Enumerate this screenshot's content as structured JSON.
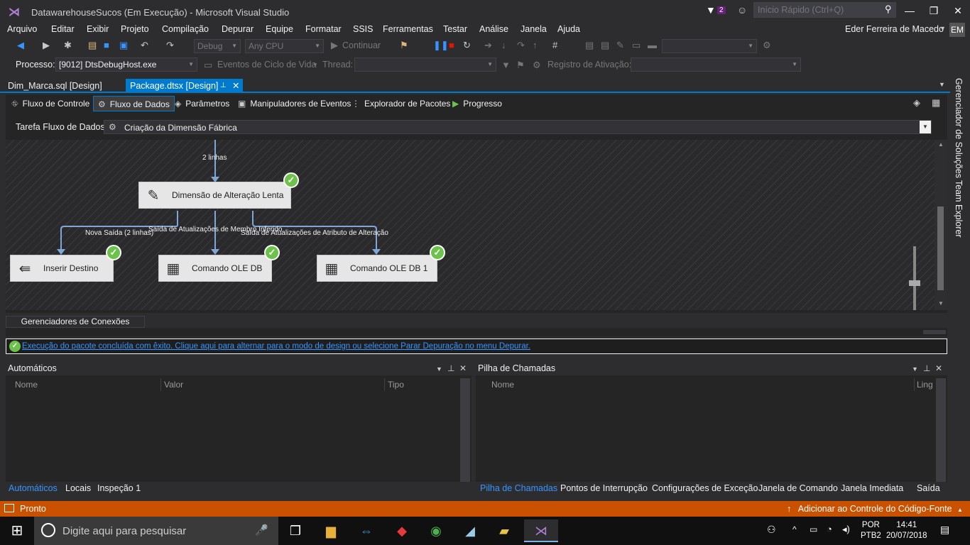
{
  "window": {
    "title": "DatawarehouseSucos (Em Execução) - Microsoft Visual Studio",
    "notification_count": "2",
    "quick_launch_placeholder": "Início Rápido (Ctrl+Q)",
    "user_name": "Eder Ferreira de Macedo",
    "user_initials": "EM"
  },
  "menu": [
    "Arquivo",
    "Editar",
    "Exibir",
    "Projeto",
    "Compilação",
    "Depurar",
    "Equipe",
    "Formatar",
    "SSIS",
    "Ferramentas",
    "Testar",
    "Análise",
    "Janela",
    "Ajuda"
  ],
  "toolbar": {
    "config": "Debug",
    "platform": "Any CPU",
    "continue_label": "Continuar",
    "process_label": "Processo:",
    "process_value": "[9012] DtsDebugHost.exe",
    "lifecycle_label": "Eventos de Ciclo de Vida",
    "thread_label": "Thread:",
    "activation_label": "Registro de Ativação:"
  },
  "doc_tabs": [
    {
      "label": "Dim_Marca.sql [Design]"
    },
    {
      "label": "Package.dtsx [Design]"
    }
  ],
  "ssis_tabs": [
    "Fluxo de Controle",
    "Fluxo de Dados",
    "Parâmetros",
    "Manipuladores de Eventos",
    "Explorador de Pacotes",
    "Progresso"
  ],
  "task": {
    "label": "Tarefa Fluxo de Dados:",
    "value": "Criação da Dimensão Fábrica"
  },
  "canvas": {
    "rows_label": "2 linhas",
    "scd_node": "Dimensão de Alteração Lenta",
    "flow_new": "Nova Saída (2 linhas)",
    "flow_inferred": "Saída de Atualizações de Membro Inferido",
    "flow_attr": "Saída de Atualizações de Atributo de Alteração",
    "dest_node": "Inserir Destino",
    "ole1_node": "Comando OLE DB",
    "ole2_node": "Comando OLE DB 1"
  },
  "connections_tab": "Gerenciadores de Conexões",
  "status_message": "Execução do pacote concluída com êxito. Clique aqui para alternar para o modo de design ou selecione Parar Depuração no menu Depurar.",
  "autos_panel": {
    "title": "Automáticos",
    "columns": [
      "Nome",
      "Valor",
      "Tipo"
    ],
    "tabs": [
      "Automáticos",
      "Locais",
      "Inspeção 1"
    ]
  },
  "callstack_panel": {
    "title": "Pilha de Chamadas",
    "columns": [
      "Nome",
      "Ling"
    ],
    "tabs": [
      "Pilha de Chamadas",
      "Pontos de Interrupção",
      "Configurações de Exceção",
      "Janela de Comando",
      "Janela Imediata",
      "Saída"
    ]
  },
  "side_rail": [
    "Gerenciador de Soluções",
    "Team Explorer"
  ],
  "statusbar": {
    "ready": "Pronto",
    "source_control": "Adicionar ao Controle do Código-Fonte"
  },
  "taskbar": {
    "search_placeholder": "Digite aqui para pesquisar",
    "lang_top": "POR",
    "lang_bottom": "PTB2",
    "time": "14:41",
    "date": "20/07/2018"
  },
  "colors": {
    "accent": "#007acc",
    "statusbar": "#ca5100",
    "success": "#6cc24a"
  }
}
